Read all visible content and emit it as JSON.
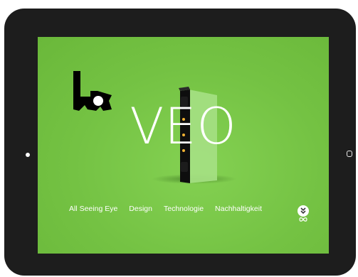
{
  "hero": {
    "title": "VEO"
  },
  "nav": {
    "items": [
      {
        "label": "All Seeing Eye"
      },
      {
        "label": "Design"
      },
      {
        "label": "Technologie"
      },
      {
        "label": "Nachhaltigkeit"
      }
    ]
  },
  "icons": {
    "logo": "brand-logo",
    "scroll": "double-chevron-down-icon",
    "loop": "infinity-icon"
  },
  "colors": {
    "background": "#74c243",
    "tablet_frame": "#1d1d1d",
    "text": "#ffffff"
  }
}
